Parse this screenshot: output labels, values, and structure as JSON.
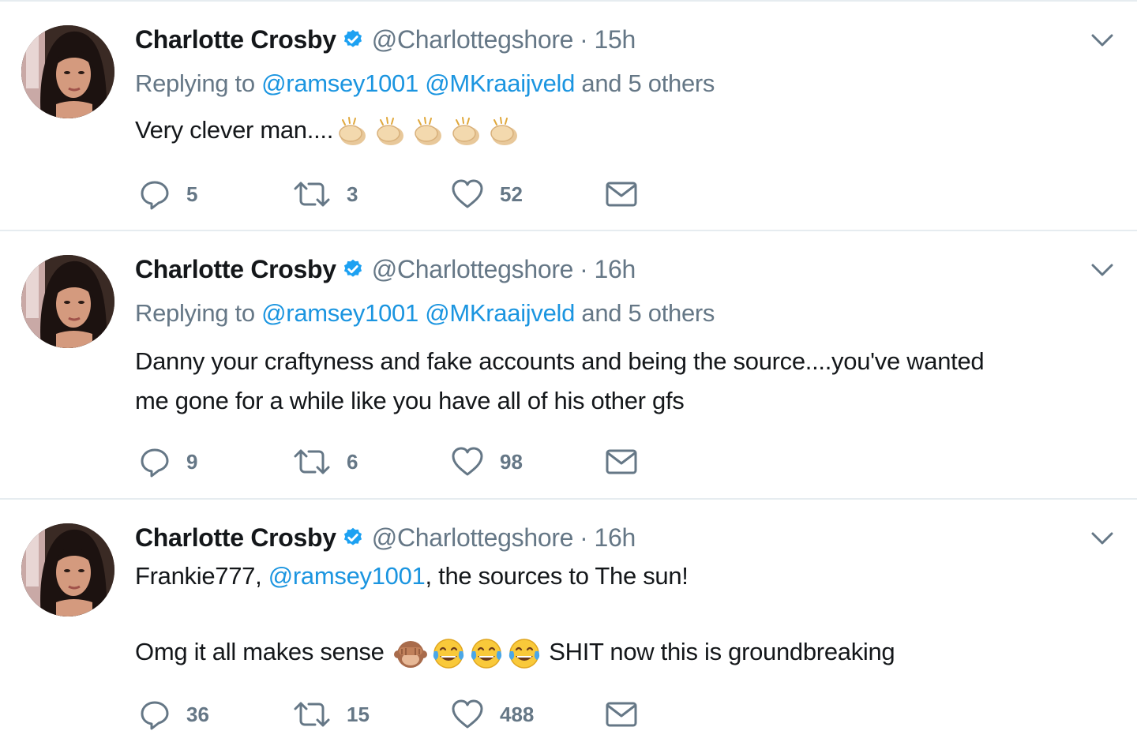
{
  "colors": {
    "link": "#1b95e0",
    "muted": "#657786",
    "text": "#14171a",
    "divider": "#e6ecf0",
    "verified": "#1da1f2"
  },
  "tweets": [
    {
      "name": "Charlotte Crosby",
      "handle": "@Charlottegshore",
      "separator": "·",
      "time": "15h",
      "reply_prefix": "Replying to",
      "reply_mentions": [
        "@ramsey1001",
        "@MKraaijveld"
      ],
      "reply_suffix": "and 5 others",
      "text": "Very clever man....",
      "emojis": [
        "clapping-hands-icon",
        "clapping-hands-icon",
        "clapping-hands-icon",
        "clapping-hands-icon",
        "clapping-hands-icon"
      ],
      "replies": "5",
      "retweets": "3",
      "likes": "52"
    },
    {
      "name": "Charlotte Crosby",
      "handle": "@Charlottegshore",
      "separator": "·",
      "time": "16h",
      "reply_prefix": "Replying to",
      "reply_mentions": [
        "@ramsey1001",
        "@MKraaijveld"
      ],
      "reply_suffix": "and 5 others",
      "text_line1": "Danny your craftyness and fake accounts and being the source....you've wanted",
      "text_line2": "me gone for a while like you have all of his other gfs",
      "replies": "9",
      "retweets": "6",
      "likes": "98"
    },
    {
      "name": "Charlotte Crosby",
      "handle": "@Charlottegshore",
      "separator": "·",
      "time": "16h",
      "text_before_mention": "Frankie777,",
      "text_mention": "@ramsey1001",
      "text_after_mention": ", the sources to The sun!",
      "text_line2_start": "Omg it all makes sense",
      "emojis": [
        "see-no-evil-monkey-icon",
        "tears-of-joy-icon",
        "tears-of-joy-icon",
        "tears-of-joy-icon"
      ],
      "text_line2_end": "SHIT now this is groundbreaking",
      "replies": "36",
      "retweets": "15",
      "likes": "488"
    }
  ]
}
